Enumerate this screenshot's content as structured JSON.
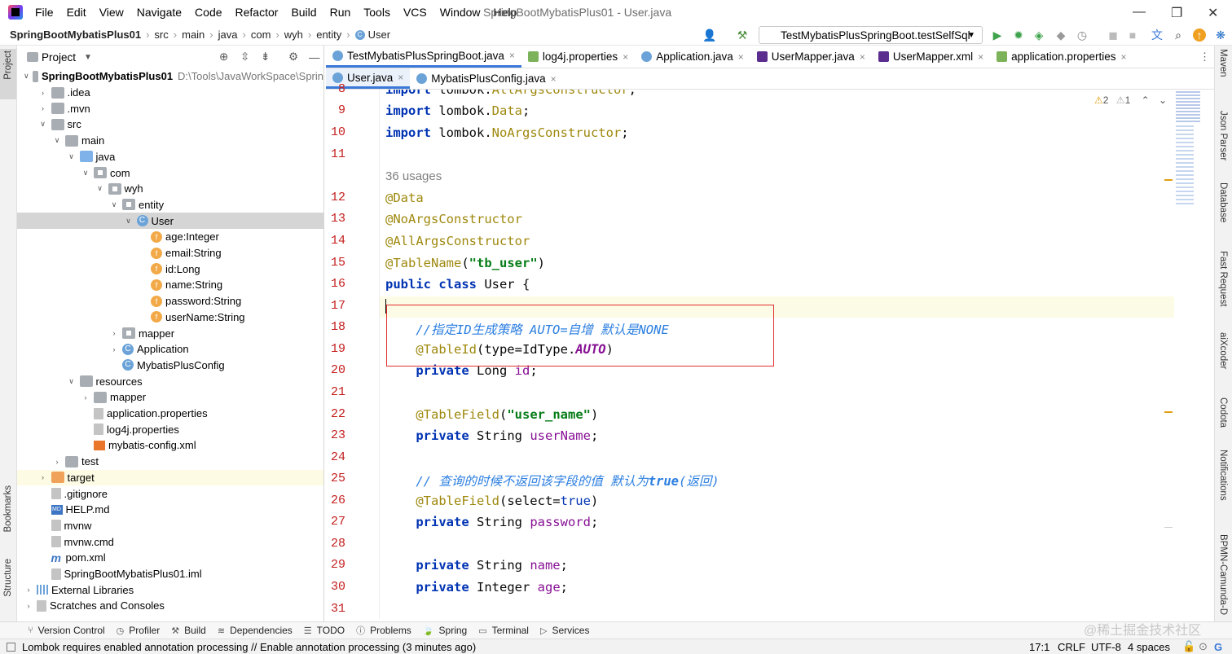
{
  "menubar": {
    "items": [
      "File",
      "Edit",
      "View",
      "Navigate",
      "Code",
      "Refactor",
      "Build",
      "Run",
      "Tools",
      "VCS",
      "Window",
      "Help"
    ],
    "title": "SpringBootMybatisPlus01 - User.java"
  },
  "breadcrumb": [
    "SpringBootMybatisPlus01",
    "src",
    "main",
    "java",
    "com",
    "wyh",
    "entity",
    "User"
  ],
  "run_config": "TestMybatisPlusSpringBoot.testSelfSql",
  "project_panel": {
    "title": "Project",
    "tree": [
      {
        "label": "SpringBootMybatisPlus01",
        "extra": "D:\\Tools\\JavaWorkSpace\\Sprin",
        "depth": 0,
        "arrow": "open",
        "icon": "folder"
      },
      {
        "label": ".idea",
        "depth": 1,
        "arrow": "closed",
        "icon": "folder"
      },
      {
        "label": ".mvn",
        "depth": 1,
        "arrow": "closed",
        "icon": "folder"
      },
      {
        "label": "src",
        "depth": 1,
        "arrow": "open",
        "icon": "folder"
      },
      {
        "label": "main",
        "depth": 2,
        "arrow": "open",
        "icon": "folder"
      },
      {
        "label": "java",
        "depth": 3,
        "arrow": "open",
        "icon": "folder-blue"
      },
      {
        "label": "com",
        "depth": 4,
        "arrow": "open",
        "icon": "package"
      },
      {
        "label": "wyh",
        "depth": 5,
        "arrow": "open",
        "icon": "package"
      },
      {
        "label": "entity",
        "depth": 6,
        "arrow": "open",
        "icon": "package"
      },
      {
        "label": "User",
        "depth": 7,
        "arrow": "open",
        "icon": "class",
        "selected": true
      },
      {
        "label": "age:Integer",
        "depth": 8,
        "arrow": "none",
        "icon": "field"
      },
      {
        "label": "email:String",
        "depth": 8,
        "arrow": "none",
        "icon": "field"
      },
      {
        "label": "id:Long",
        "depth": 8,
        "arrow": "none",
        "icon": "field"
      },
      {
        "label": "name:String",
        "depth": 8,
        "arrow": "none",
        "icon": "field"
      },
      {
        "label": "password:String",
        "depth": 8,
        "arrow": "none",
        "icon": "field"
      },
      {
        "label": "userName:String",
        "depth": 8,
        "arrow": "none",
        "icon": "field"
      },
      {
        "label": "mapper",
        "depth": 6,
        "arrow": "closed",
        "icon": "package"
      },
      {
        "label": "Application",
        "depth": 6,
        "arrow": "closed",
        "icon": "class"
      },
      {
        "label": "MybatisPlusConfig",
        "depth": 6,
        "arrow": "none",
        "icon": "class"
      },
      {
        "label": "resources",
        "depth": 3,
        "arrow": "open",
        "icon": "folder"
      },
      {
        "label": "mapper",
        "depth": 4,
        "arrow": "closed",
        "icon": "folder"
      },
      {
        "label": "application.properties",
        "depth": 4,
        "arrow": "none",
        "icon": "file"
      },
      {
        "label": "log4j.properties",
        "depth": 4,
        "arrow": "none",
        "icon": "file"
      },
      {
        "label": "mybatis-config.xml",
        "depth": 4,
        "arrow": "none",
        "icon": "xml"
      },
      {
        "label": "test",
        "depth": 2,
        "arrow": "closed",
        "icon": "folder"
      },
      {
        "label": "target",
        "depth": 1,
        "arrow": "closed",
        "icon": "folder-orange",
        "target": true
      },
      {
        "label": ".gitignore",
        "depth": 1,
        "arrow": "none",
        "icon": "file"
      },
      {
        "label": "HELP.md",
        "depth": 1,
        "arrow": "none",
        "icon": "md"
      },
      {
        "label": "mvnw",
        "depth": 1,
        "arrow": "none",
        "icon": "file"
      },
      {
        "label": "mvnw.cmd",
        "depth": 1,
        "arrow": "none",
        "icon": "file"
      },
      {
        "label": "pom.xml",
        "depth": 1,
        "arrow": "none",
        "icon": "m"
      },
      {
        "label": "SpringBootMybatisPlus01.iml",
        "depth": 1,
        "arrow": "none",
        "icon": "file"
      },
      {
        "label": "External Libraries",
        "depth": 0,
        "arrow": "closed",
        "icon": "lib"
      },
      {
        "label": "Scratches and Consoles",
        "depth": 0,
        "arrow": "closed",
        "icon": "file"
      }
    ]
  },
  "tabs_row1": [
    {
      "label": "TestMybatisPlusSpringBoot.java",
      "icon": "class",
      "active": true
    },
    {
      "label": "log4j.properties",
      "icon": "prop"
    },
    {
      "label": "Application.java",
      "icon": "class"
    },
    {
      "label": "UserMapper.java",
      "icon": "bird"
    },
    {
      "label": "UserMapper.xml",
      "icon": "bird"
    },
    {
      "label": "application.properties",
      "icon": "prop"
    }
  ],
  "tabs_row2": [
    {
      "label": "User.java",
      "icon": "class",
      "active": true
    },
    {
      "label": "MybatisPlusConfig.java",
      "icon": "class"
    }
  ],
  "inspections": {
    "warnings": "2",
    "weak": "1"
  },
  "editor": {
    "line_numbers": [
      "8",
      "9",
      "10",
      "11",
      "",
      "12",
      "13",
      "14",
      "15",
      "16",
      "17",
      "18",
      "19",
      "20",
      "21",
      "22",
      "23",
      "24",
      "25",
      "26",
      "27",
      "28",
      "29",
      "30",
      "31"
    ],
    "usages_hint": "36 usages"
  },
  "bottom_tools": [
    "Version Control",
    "Profiler",
    "Build",
    "Dependencies",
    "TODO",
    "Problems",
    "Spring",
    "Terminal",
    "Services"
  ],
  "status": {
    "message": "Lombok requires enabled annotation processing // Enable annotation processing (3 minutes ago)",
    "position": "17:1",
    "line_sep": "CRLF",
    "encoding": "UTF-8",
    "indent": "4 spaces"
  },
  "left_strip": [
    "Project",
    "Bookmarks",
    "Structure"
  ],
  "right_strip": [
    "Maven",
    "Json Parser",
    "Database",
    "Fast Request",
    "aiXcoder",
    "Codota",
    "Notifications",
    "BPMN-Camunda-D"
  ],
  "watermark": "@稀土掘金技术社区",
  "colors": {
    "accent": "#3b79d8",
    "highlight_box": "#e03131",
    "line_number": "#c41e1e"
  }
}
